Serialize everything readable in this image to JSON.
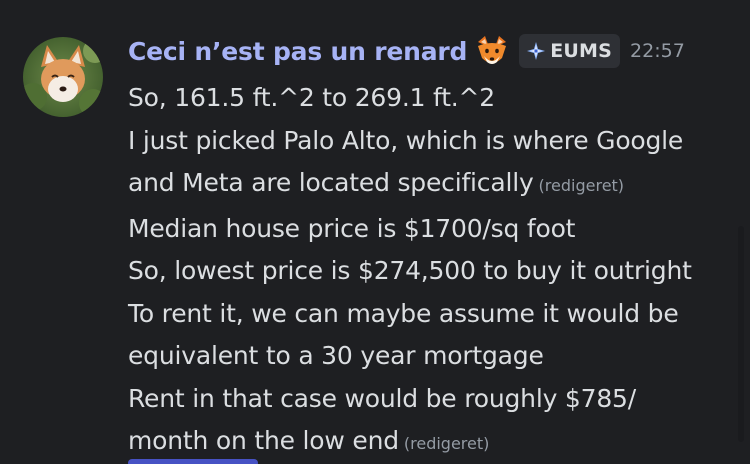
{
  "message": {
    "author": "Ceci n’est pas un renard",
    "author_emoji": "fox-emoji",
    "avatar": "fox-avatar",
    "tag": {
      "icon": "compass-star-icon",
      "label": "EUMS"
    },
    "timestamp": "22:57",
    "lines": [
      {
        "text": "So, 161.5 ft.^2 to 269.1 ft.^2"
      },
      {
        "text": "I just picked Palo Alto, which is where Google"
      },
      {
        "text": "and Meta are located specifically",
        "edited": "(redigeret)"
      },
      {
        "text": "Median house price is $1700/sq foot"
      },
      {
        "text": "So, lowest price is $274,500 to buy it outright"
      },
      {
        "text": "To rent it, we can maybe assume it would be"
      },
      {
        "text": "equivalent to a 30 year mortgage"
      },
      {
        "text": "Rent in that case would be roughly $785/"
      },
      {
        "text": "month on the low end",
        "edited": "(redigeret)"
      }
    ]
  },
  "colors": {
    "background": "#1e1f22",
    "username": "#a7b3f5",
    "text": "#dbdee1",
    "muted": "#949ba4",
    "badge_bg": "#2e3035"
  }
}
